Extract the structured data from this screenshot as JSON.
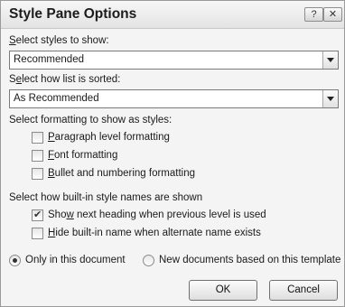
{
  "dialog": {
    "title": "Style Pane Options",
    "help_button": "?",
    "close_button": "✕"
  },
  "styles_to_show": {
    "label_pre": "",
    "label_key": "S",
    "label_post": "elect styles to show:",
    "value": "Recommended"
  },
  "sort": {
    "label_pre": "S",
    "label_key": "e",
    "label_post": "lect how list is sorted:",
    "value": "As Recommended"
  },
  "formatting": {
    "heading": "Select formatting to show as styles:",
    "options": [
      {
        "pre": "",
        "key": "P",
        "post": "aragraph level formatting",
        "checked": false
      },
      {
        "pre": "",
        "key": "F",
        "post": "ont formatting",
        "checked": false
      },
      {
        "pre": "",
        "key": "B",
        "post": "ullet and numbering formatting",
        "checked": false
      }
    ]
  },
  "builtin": {
    "heading": "Select how built-in style names are shown",
    "options": [
      {
        "pre": "Sho",
        "key": "w",
        "post": " next heading when previous level is used",
        "checked": true
      },
      {
        "pre": "",
        "key": "H",
        "post": "ide built-in name when alternate name exists",
        "checked": false
      }
    ]
  },
  "scope": {
    "option1": "Only in this document",
    "option2": "New documents based on this template",
    "selected": "option1"
  },
  "buttons": {
    "ok": "OK",
    "cancel": "Cancel"
  }
}
